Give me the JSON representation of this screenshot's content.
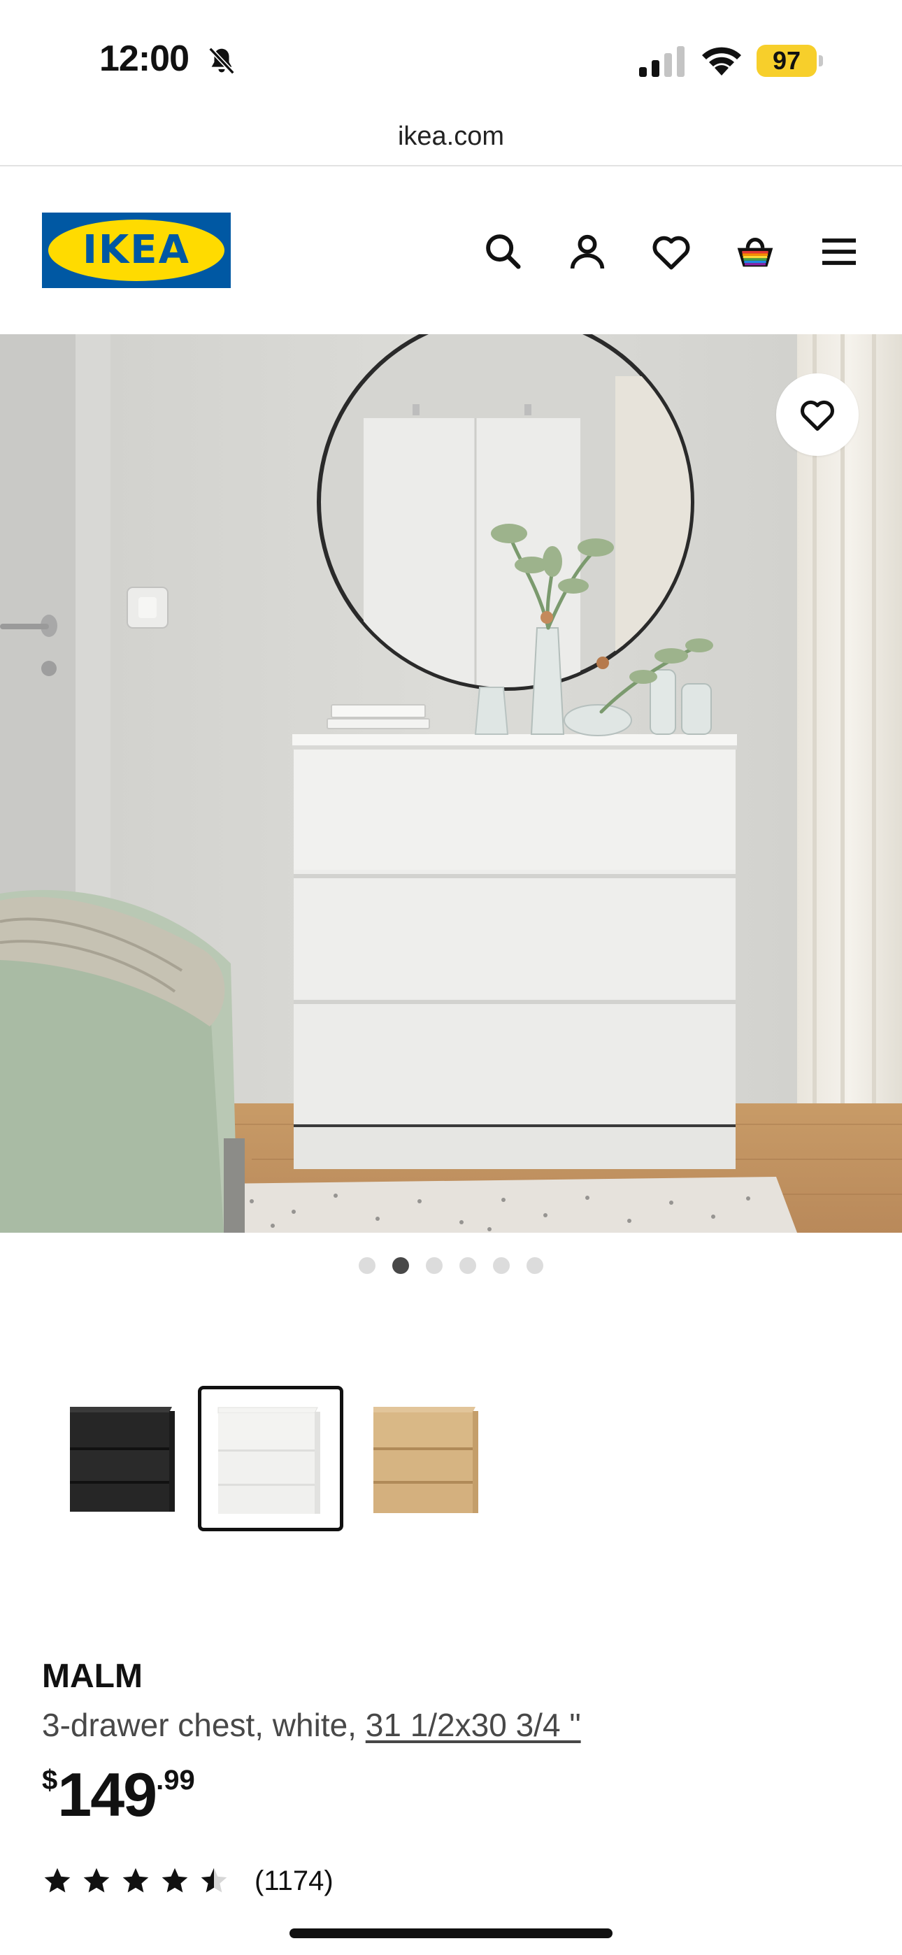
{
  "status_bar": {
    "time": "12:00",
    "battery": "97",
    "icons": [
      "bell-slash-icon",
      "cellular-signal-icon",
      "wifi-icon",
      "battery-icon"
    ]
  },
  "browser": {
    "url": "ikea.com"
  },
  "header": {
    "logo_text": "IKEA",
    "icons": [
      "search-icon",
      "account-icon",
      "heart-icon",
      "shopping-bag-icon",
      "menu-icon"
    ]
  },
  "gallery": {
    "image_count": 6,
    "active_index": 1,
    "favorite_icon": "heart-icon"
  },
  "variants": [
    {
      "color_name": "black-brown",
      "color": "#2a2a2a"
    },
    {
      "color_name": "white",
      "color": "#f2f2f0",
      "selected": true
    },
    {
      "color_name": "white stained oak",
      "color": "#d8b887"
    }
  ],
  "product": {
    "name": "MALM",
    "description": "3-drawer chest, white, ",
    "size": "31 1/2x30 3/4 \"",
    "price_currency": "$",
    "price_whole": "149",
    "price_cents": ".99",
    "rating": 4.5,
    "review_count": "(1174)"
  },
  "colors": {
    "ikea_blue": "#0058a3",
    "ikea_yellow": "#ffdb00",
    "battery_yellow": "#f7cf2b"
  }
}
